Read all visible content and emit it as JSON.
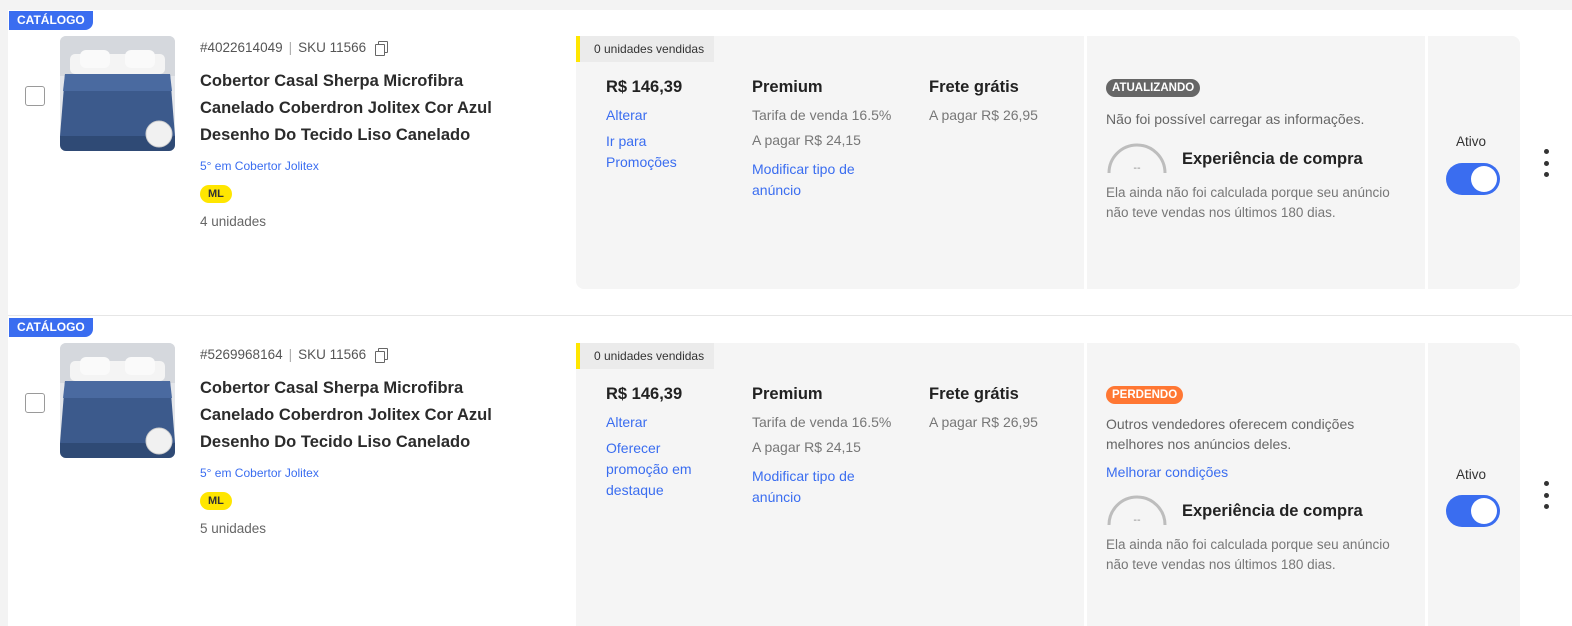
{
  "listings": [
    {
      "badge": "CATÁLOGO",
      "id": "#4022614049",
      "sku": "SKU 11566",
      "title": "Cobertor Casal Sherpa Microfibra Canelado Coberdron Jolitex Cor Azul Desenho Do Tecido Liso Canelado",
      "rank": "5° em Cobertor Jolitex",
      "ml_badge": "ML",
      "units": "4 unidades",
      "sold": "0 unidades vendidas",
      "price": "R$ 146,39",
      "price_links": [
        "Alterar",
        "Ir para Promoções"
      ],
      "listing_type": "Premium",
      "fee": "Tarifa de venda 16.5%",
      "fee_to_pay": "A pagar R$ 24,15",
      "modify_link": "Modificar tipo de anúncio",
      "shipping": "Frete grátis",
      "shipping_to_pay": "A pagar R$ 26,95",
      "status": "ATUALIZANDO",
      "status_color": "#666666",
      "status_message": "Não foi possível carregar as informações.",
      "improve_link": "",
      "gauge_value": "--",
      "experience_title": "Experiência de compra",
      "experience_desc": "Ela ainda não foi calculada porque seu anúncio não teve vendas nos últimos 180 dias.",
      "toggle_label": "Ativo",
      "active": true
    },
    {
      "badge": "CATÁLOGO",
      "id": "#5269968164",
      "sku": "SKU 11566",
      "title": "Cobertor Casal Sherpa Microfibra Canelado Coberdron Jolitex Cor Azul Desenho Do Tecido Liso Canelado",
      "rank": "5° em Cobertor Jolitex",
      "ml_badge": "ML",
      "units": "5 unidades",
      "sold": "0 unidades vendidas",
      "price": "R$ 146,39",
      "price_links": [
        "Alterar",
        "Oferecer promoção em destaque"
      ],
      "listing_type": "Premium",
      "fee": "Tarifa de venda 16.5%",
      "fee_to_pay": "A pagar R$ 24,15",
      "modify_link": "Modificar tipo de anúncio",
      "shipping": "Frete grátis",
      "shipping_to_pay": "A pagar R$ 26,95",
      "status": "PERDENDO",
      "status_color": "#ff7733",
      "status_message": "Outros vendedores oferecem condições melhores nos anúncios deles.",
      "improve_link": "Melhorar condições",
      "gauge_value": "--",
      "experience_title": "Experiência de compra",
      "experience_desc": "Ela ainda não foi calculada porque seu anúncio não teve vendas nos últimos 180 dias.",
      "toggle_label": "Ativo",
      "active": true
    }
  ],
  "colors": {
    "accent": "#3a6df0",
    "ml_yellow": "#ffe600",
    "panel_bg": "#f5f5f5"
  },
  "icons": [
    "copy-icon",
    "kebab-menu-icon",
    "gauge-icon"
  ]
}
